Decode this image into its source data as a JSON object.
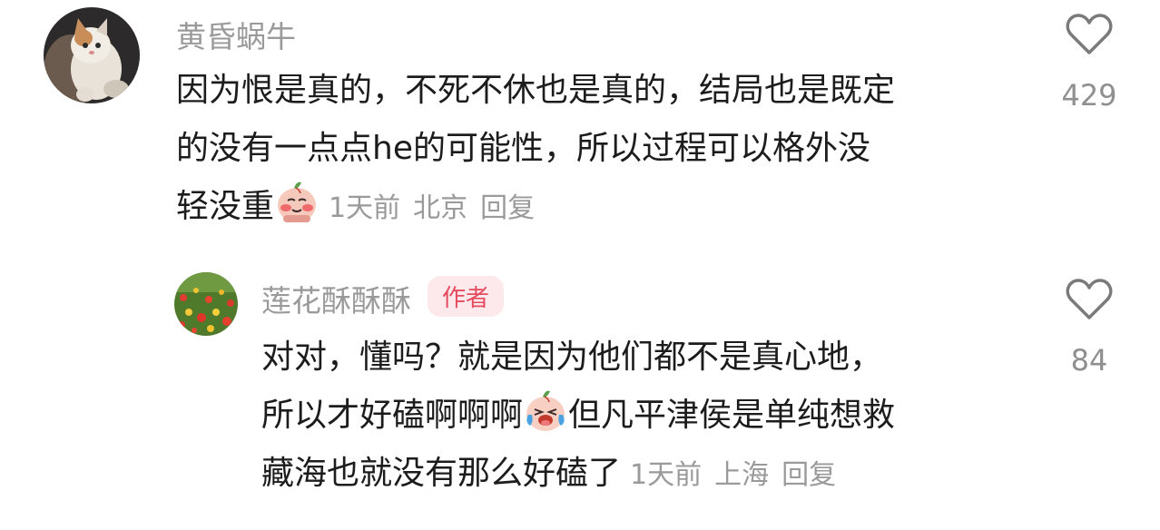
{
  "comments": [
    {
      "username": "黄昏蜗牛",
      "avatar_icon": "kitten-avatar",
      "text_lines": [
        "因为恨是真的，不死不休也是真的，结局也是既定",
        "的没有一点点he的可能性，所以过程可以格外没",
        "轻没重"
      ],
      "emoji": "blushing-peach-emoji",
      "time": "1天前",
      "location": "北京",
      "reply_label": "回复",
      "like_count": "429",
      "like_icon": "heart-icon"
    },
    {
      "username": "莲花酥酥酥",
      "badge": "作者",
      "avatar_icon": "flower-field-avatar",
      "text_lines_a": [
        "对对，懂吗？就是因为他们都不是真心地，"
      ],
      "line2_before_emoji": "所以才好磕啊啊啊",
      "line2_after_emoji": "但凡平津侯是单纯想救",
      "line3": "藏海也就没有那么好磕了",
      "emoji": "crying-laughing-peach-emoji",
      "time": "1天前",
      "location": "上海",
      "reply_label": "回复",
      "like_count": "84",
      "like_icon": "heart-icon"
    }
  ]
}
